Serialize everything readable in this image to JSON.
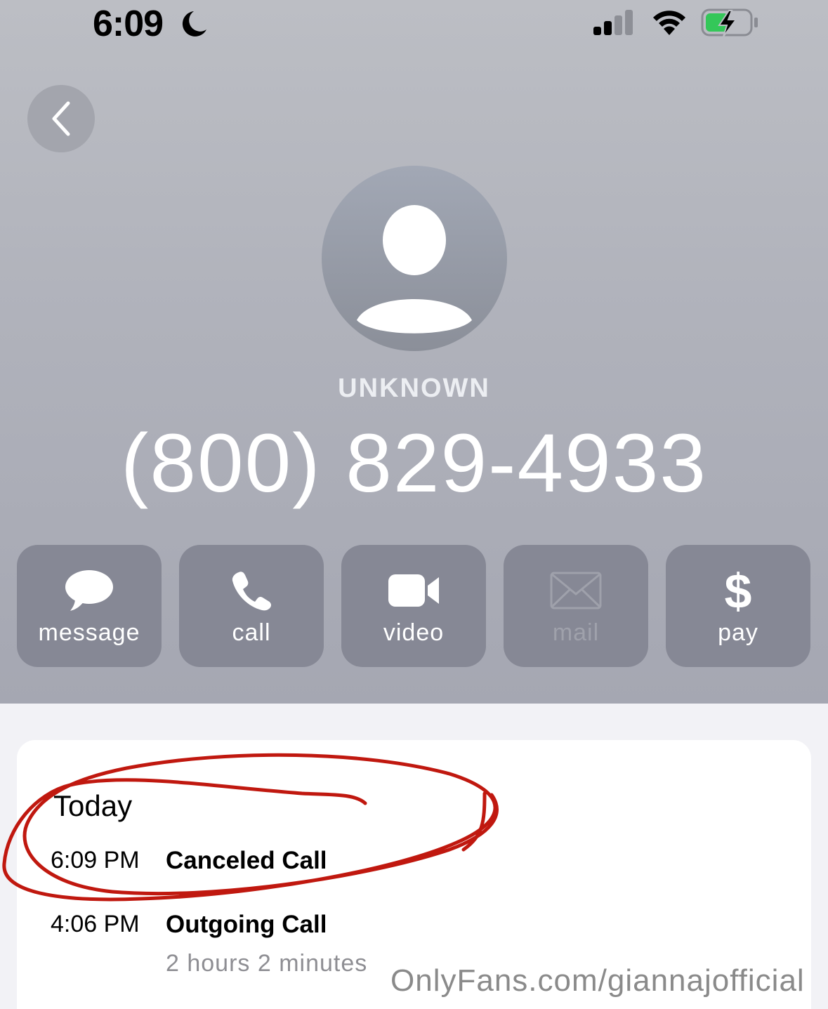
{
  "status_bar": {
    "time": "6:09",
    "focus_icon": "moon-icon",
    "signal_icon": "cellular-signal-icon",
    "wifi_icon": "wifi-icon",
    "battery_icon": "battery-charging-icon",
    "battery_color": "#34c759"
  },
  "nav": {
    "back_icon": "chevron-left-icon"
  },
  "contact": {
    "avatar_icon": "person-placeholder-icon",
    "label": "UNKNOWN",
    "number": "(800) 829-4933"
  },
  "actions": [
    {
      "label": "message",
      "icon": "message-bubble-icon",
      "enabled": true
    },
    {
      "label": "call",
      "icon": "phone-icon",
      "enabled": true
    },
    {
      "label": "video",
      "icon": "video-camera-icon",
      "enabled": true
    },
    {
      "label": "mail",
      "icon": "envelope-icon",
      "enabled": false
    },
    {
      "label": "pay",
      "icon": "dollar-icon",
      "enabled": true
    }
  ],
  "history": {
    "day": "Today",
    "calls": [
      {
        "time": "6:09 PM",
        "type": "Canceled Call",
        "duration": ""
      },
      {
        "time": "4:06 PM",
        "type": "Outgoing Call",
        "duration": "2 hours 2 minutes"
      }
    ]
  },
  "annotation": {
    "ink_color": "#c0180f"
  },
  "watermark": "OnlyFans.com/giannajofficial"
}
